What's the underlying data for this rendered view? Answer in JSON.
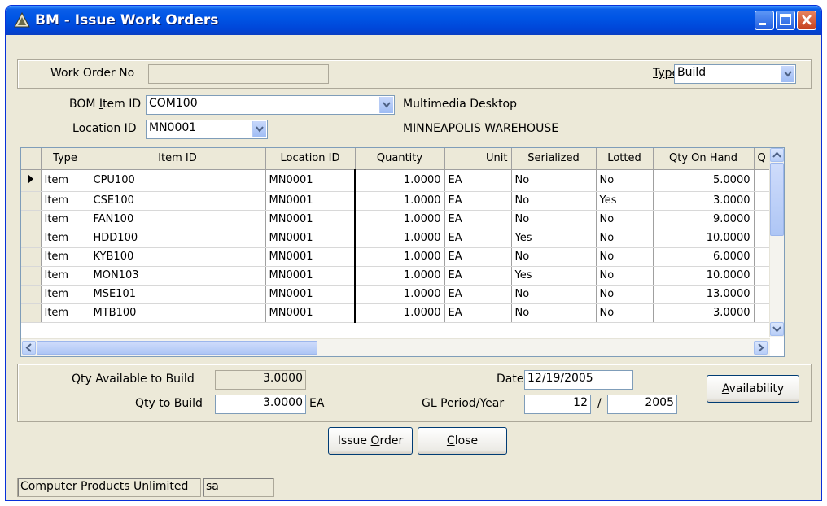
{
  "window": {
    "title": "BM - Issue Work Orders"
  },
  "header": {
    "work_order_label": "Work Order No",
    "work_order_value": "",
    "type_label": "Type",
    "type_value": "Build",
    "bom_item_label": "BOM Item ID",
    "bom_item_value": "COM100",
    "bom_item_desc": "Multimedia Desktop",
    "location_label": "Location ID",
    "location_value": "MN0001",
    "location_desc": "MINNEAPOLIS WAREHOUSE"
  },
  "grid": {
    "columns": [
      "Type",
      "Item ID",
      "Location ID",
      "Quantity",
      "Unit",
      "Serialized",
      "Lotted",
      "Qty On Hand",
      "Q"
    ],
    "rows": [
      {
        "type": "Item",
        "item": "CPU100",
        "loc": "MN0001",
        "qty": "1.0000",
        "unit": "EA",
        "serialized": "No",
        "lotted": "No",
        "onhand": "5.0000"
      },
      {
        "type": "Item",
        "item": "CSE100",
        "loc": "MN0001",
        "qty": "1.0000",
        "unit": "EA",
        "serialized": "No",
        "lotted": "Yes",
        "onhand": "3.0000"
      },
      {
        "type": "Item",
        "item": "FAN100",
        "loc": "MN0001",
        "qty": "1.0000",
        "unit": "EA",
        "serialized": "No",
        "lotted": "No",
        "onhand": "9.0000"
      },
      {
        "type": "Item",
        "item": "HDD100",
        "loc": "MN0001",
        "qty": "1.0000",
        "unit": "EA",
        "serialized": "Yes",
        "lotted": "No",
        "onhand": "10.0000"
      },
      {
        "type": "Item",
        "item": "KYB100",
        "loc": "MN0001",
        "qty": "1.0000",
        "unit": "EA",
        "serialized": "No",
        "lotted": "No",
        "onhand": "6.0000"
      },
      {
        "type": "Item",
        "item": "MON103",
        "loc": "MN0001",
        "qty": "1.0000",
        "unit": "EA",
        "serialized": "Yes",
        "lotted": "No",
        "onhand": "10.0000"
      },
      {
        "type": "Item",
        "item": "MSE101",
        "loc": "MN0001",
        "qty": "1.0000",
        "unit": "EA",
        "serialized": "No",
        "lotted": "No",
        "onhand": "13.0000"
      },
      {
        "type": "Item",
        "item": "MTB100",
        "loc": "MN0001",
        "qty": "1.0000",
        "unit": "EA",
        "serialized": "No",
        "lotted": "No",
        "onhand": "3.0000"
      }
    ]
  },
  "footer": {
    "qty_avail_label": "Qty Available to Build",
    "qty_avail_value": "3.0000",
    "qty_build_label": "Qty to Build",
    "qty_build_value": "3.0000",
    "qty_build_unit": "EA",
    "date_label": "Date",
    "date_value": "12/19/2005",
    "gl_label": "GL Period/Year",
    "gl_period": "12",
    "gl_sep": "/",
    "gl_year": "2005",
    "availability_button": "Availability"
  },
  "buttons": {
    "issue_order": "Issue Order",
    "close": "Close"
  },
  "status": {
    "company": "Computer Products Unlimited",
    "user": "sa"
  },
  "colors": {
    "titlebar": "#0055e5",
    "face": "#ece9d8",
    "field_border": "#7f9db9"
  }
}
